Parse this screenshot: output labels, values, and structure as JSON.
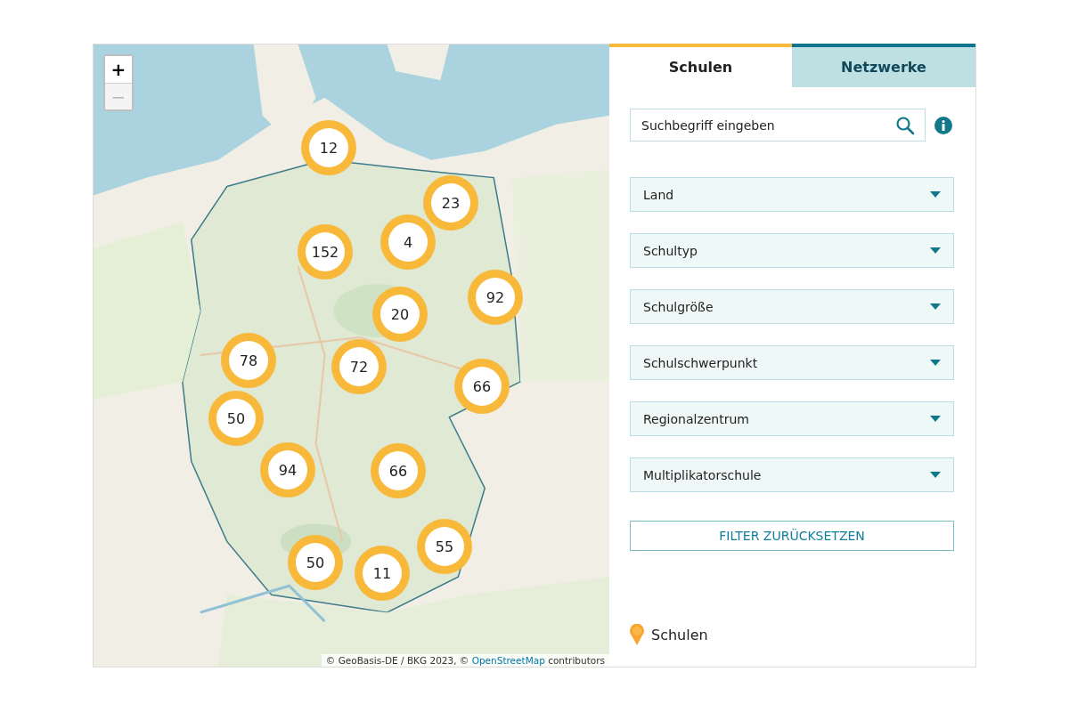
{
  "map": {
    "zoom_in": {
      "label": "+",
      "disabled": false
    },
    "zoom_out": {
      "label": "−",
      "disabled": true
    },
    "clusters": [
      {
        "count": "12"
      },
      {
        "count": "23"
      },
      {
        "count": "4"
      },
      {
        "count": "152"
      },
      {
        "count": "92"
      },
      {
        "count": "20"
      },
      {
        "count": "78"
      },
      {
        "count": "72"
      },
      {
        "count": "66"
      },
      {
        "count": "50"
      },
      {
        "count": "94"
      },
      {
        "count": "66"
      },
      {
        "count": "55"
      },
      {
        "count": "50"
      },
      {
        "count": "11"
      }
    ],
    "attribution": {
      "prefix": "© GeoBasis-DE / BKG 2023, ©",
      "link": "OpenStreetMap",
      "suffix": "contributors"
    }
  },
  "tabs": [
    {
      "label": "Schulen",
      "selected": true
    },
    {
      "label": "Netzwerke",
      "selected": false
    }
  ],
  "search": {
    "placeholder": "Suchbegriff eingeben"
  },
  "filters": [
    {
      "label": "Land"
    },
    {
      "label": "Schultyp"
    },
    {
      "label": "Schulgröße"
    },
    {
      "label": "Schulschwerpunkt"
    },
    {
      "label": "Regionalzentrum"
    },
    {
      "label": "Multiplikatorschule"
    }
  ],
  "reset_button": "FILTER ZURÜCKSETZEN",
  "legend": [
    {
      "label": "Schulen"
    }
  ]
}
